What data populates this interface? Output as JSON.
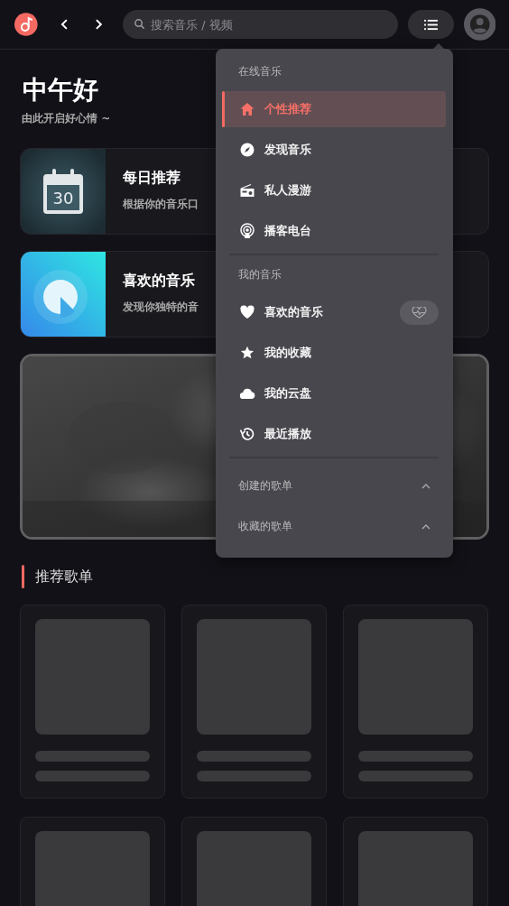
{
  "header": {
    "search": {
      "placeholder": "搜索音乐 / 视频"
    }
  },
  "greeting": {
    "title": "中午好",
    "subtitle": "由此开启好心情 ~"
  },
  "cards": [
    {
      "kind": "daily",
      "title": "每日推荐",
      "subtitle": "根据你的音乐口",
      "date": "30"
    },
    {
      "kind": "liked",
      "title": "喜欢的音乐",
      "subtitle": "发现你独特的音"
    }
  ],
  "section_title": "推荐歌单",
  "menu": {
    "sections": [
      {
        "label": "在线音乐",
        "items": [
          {
            "kind": "home",
            "label": "个性推荐",
            "selected": true
          },
          {
            "kind": "compass",
            "label": "发现音乐",
            "selected": false
          },
          {
            "kind": "radio",
            "label": "私人漫游",
            "selected": false
          },
          {
            "kind": "podcast",
            "label": "播客电台",
            "selected": false
          }
        ]
      },
      {
        "label": "我的音乐",
        "items": [
          {
            "kind": "heart",
            "label": "喜欢的音乐",
            "selected": false
          },
          {
            "kind": "star",
            "label": "我的收藏",
            "selected": false
          },
          {
            "kind": "cloud",
            "label": "我的云盘",
            "selected": false
          },
          {
            "kind": "history",
            "label": "最近播放",
            "selected": false
          }
        ]
      }
    ],
    "playlists": [
      {
        "label": "创建的歌单",
        "expanded": true
      },
      {
        "label": "收藏的歌单",
        "expanded": true
      }
    ]
  }
}
